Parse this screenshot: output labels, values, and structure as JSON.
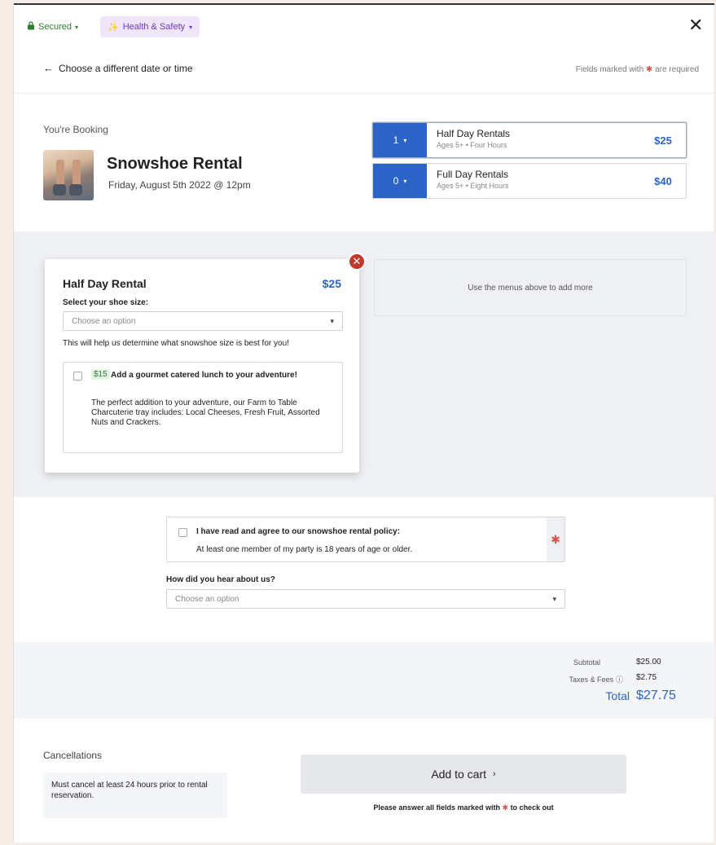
{
  "topbar": {
    "secured_label": "Secured",
    "health_label": "Health & Safety",
    "close_glyph": "✕"
  },
  "nav": {
    "back_label": "Choose a different date or time",
    "required_prefix": "Fields marked with",
    "required_suffix": "are required"
  },
  "booking": {
    "label": "You're Booking",
    "title": "Snowshoe Rental",
    "date": "Friday, August 5th 2022 @ 12pm",
    "rentals": [
      {
        "qty": "1",
        "name": "Half Day Rentals",
        "sub": "Ages 5+ • Four Hours",
        "price": "$25"
      },
      {
        "qty": "0",
        "name": "Full Day Rentals",
        "sub": "Ages 5+ • Eight Hours",
        "price": "$40"
      }
    ]
  },
  "item_card": {
    "title": "Half Day Rental",
    "price": "$25",
    "shoe_label": "Select your shoe size:",
    "shoe_placeholder": "Choose an option",
    "help_text": "This will help us determine what snowshoe size is best for you!",
    "addon": {
      "price": "$15",
      "title": "Add a gourmet catered lunch to your adventure!",
      "desc": "The perfect addition to your adventure, our Farm to Table Charcuterie tray includes: Local Cheeses, Fresh Fruit, Assorted Nuts and Crackers."
    },
    "use_menus_text": "Use the menus above to add more"
  },
  "policy": {
    "title": "I have read and agree to our snowshoe rental policy:",
    "sub": "At least one member of my party is 18 years of age or older.",
    "hear_label": "How did you hear about us?",
    "hear_placeholder": "Choose an option"
  },
  "totals": {
    "subtotal_label": "Subtotal",
    "subtotal": "$25.00",
    "taxes_label": "Taxes & Fees",
    "taxes": "$2.75",
    "total_label": "Total",
    "total": "$27.75"
  },
  "footer": {
    "cancel_title": "Cancellations",
    "cancel_text": "Must cancel at least 24 hours prior to rental reservation.",
    "cart_label": "Add to cart",
    "checkout_prefix": "Please answer all fields marked with",
    "checkout_suffix": "to check out"
  },
  "colors": {
    "accent": "#2b63c6",
    "secured": "#2e7d32",
    "health": "#6a38c2",
    "required": "#d9534f"
  }
}
